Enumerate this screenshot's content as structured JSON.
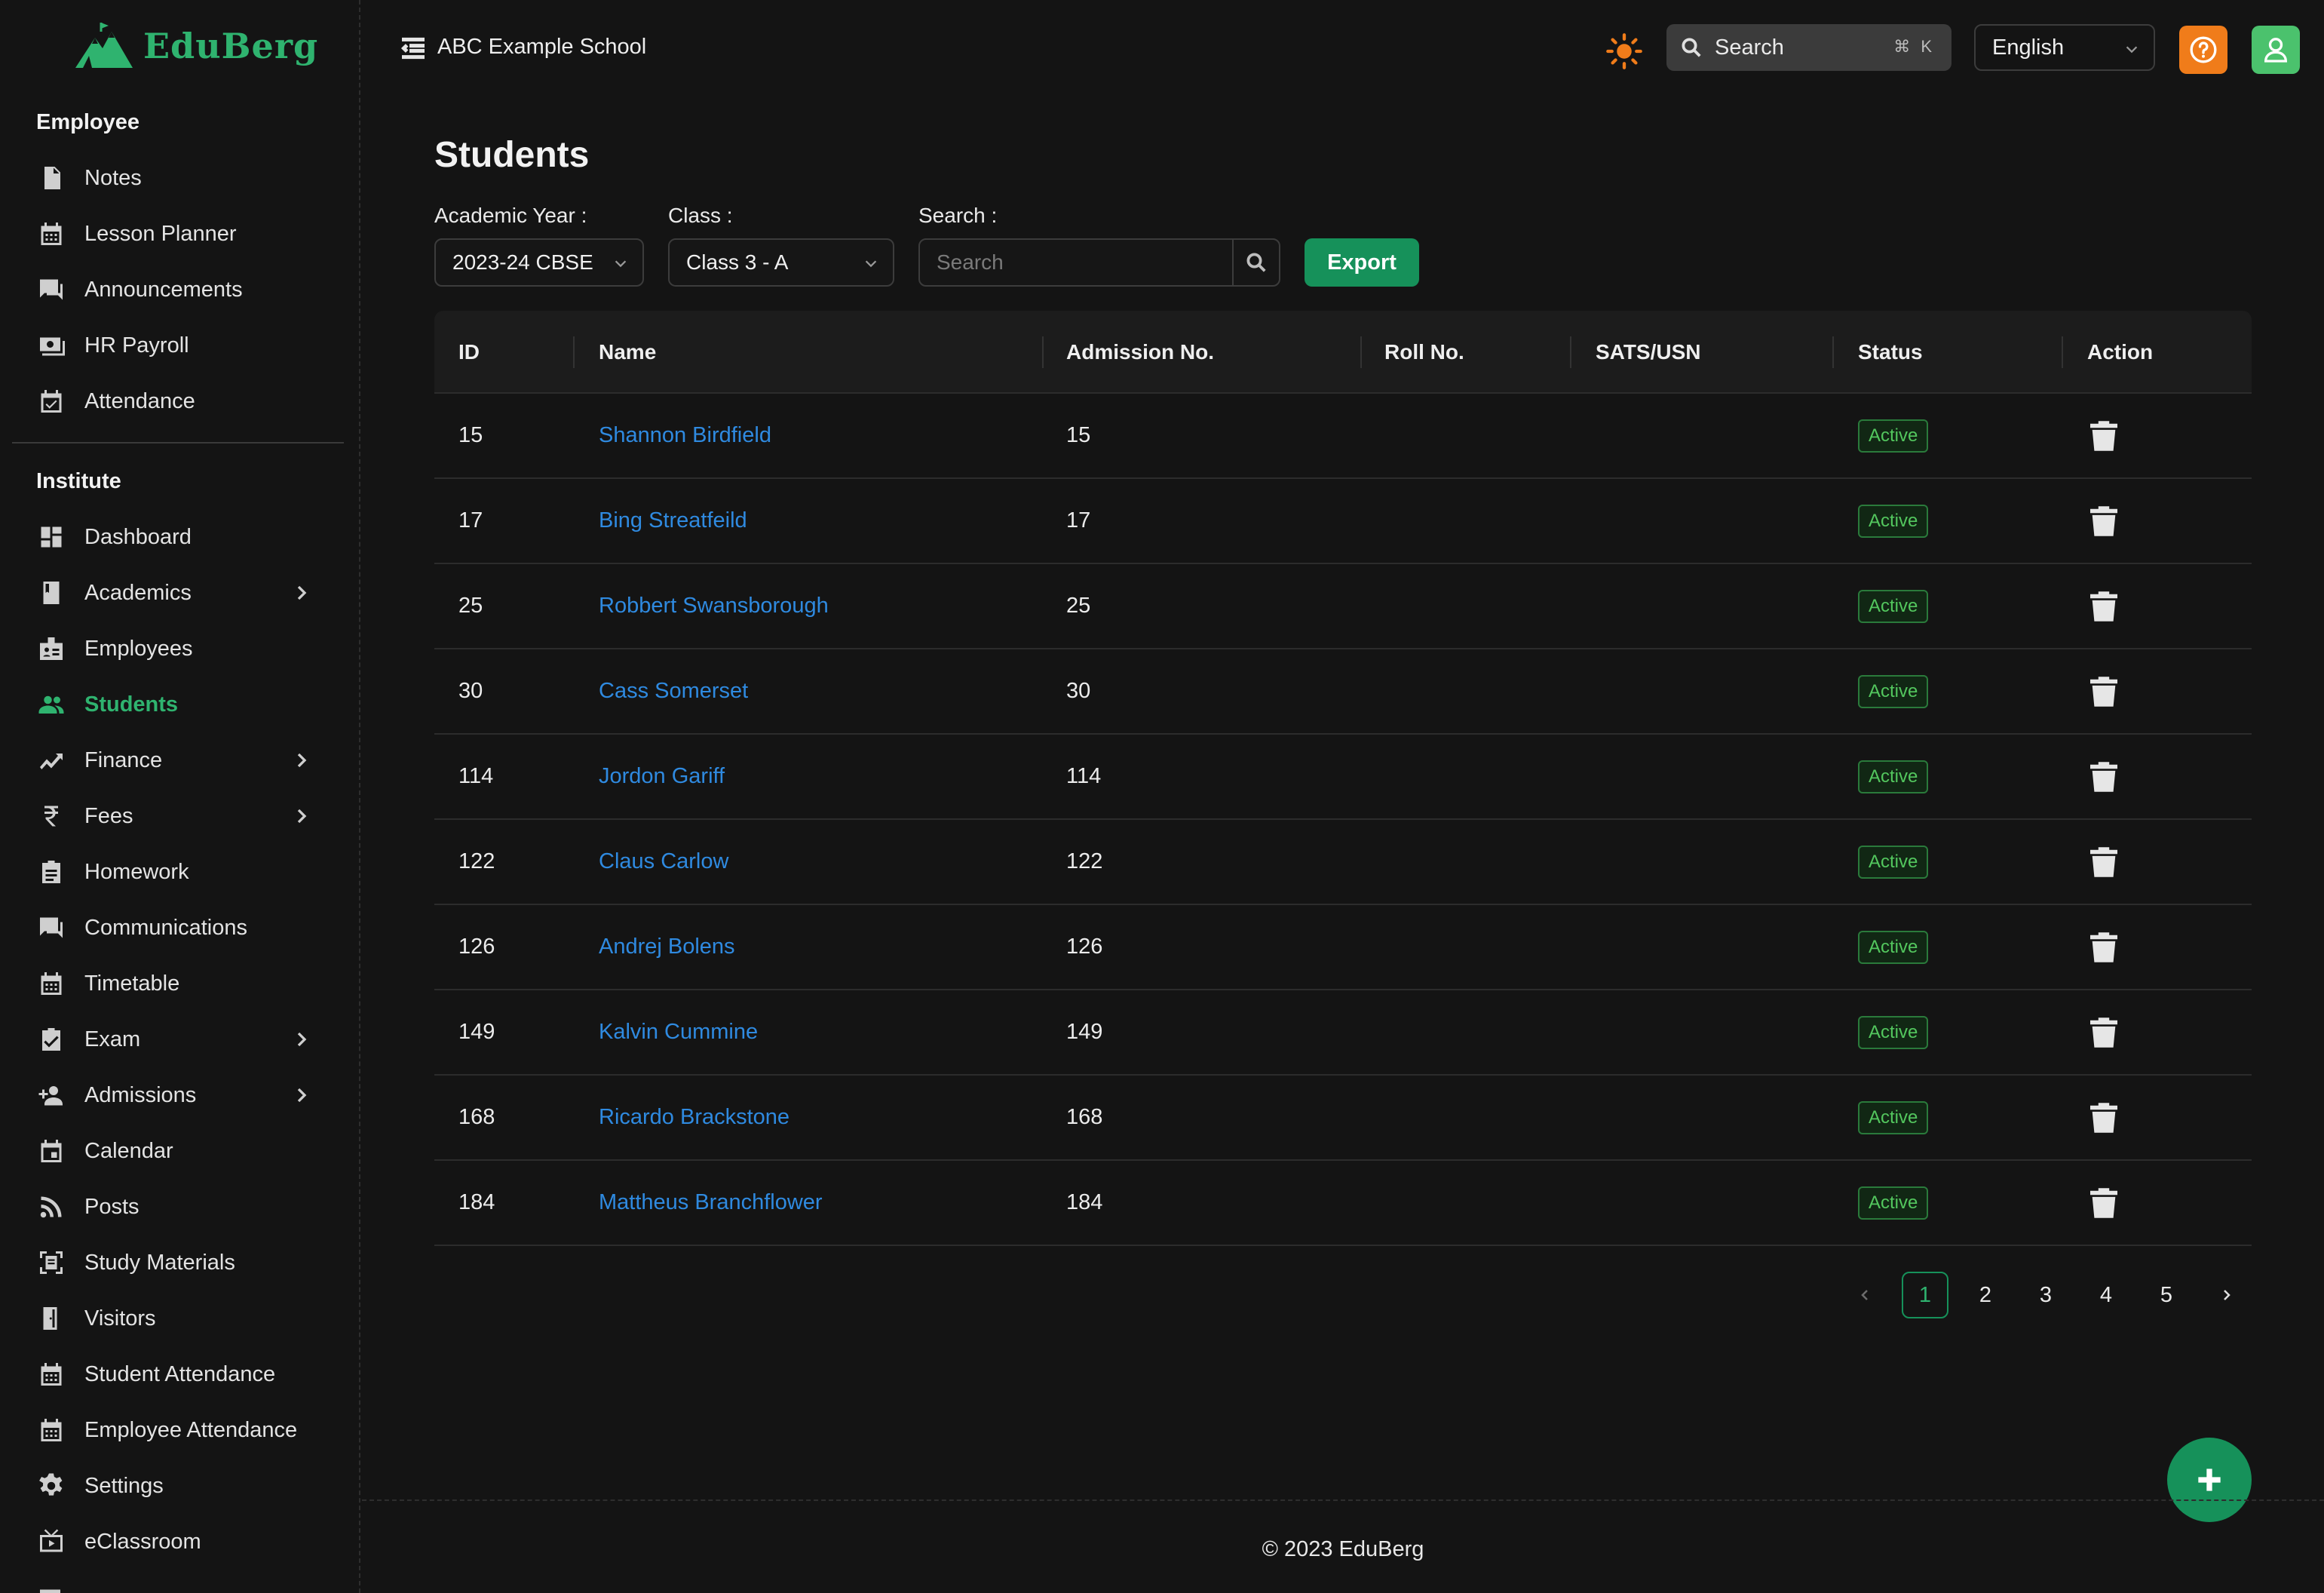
{
  "brand": {
    "name": "EduBerg",
    "accent": "#16915a",
    "logo_green": "#2fb36f"
  },
  "topbar": {
    "school_name": "ABC Example School",
    "search_placeholder": "Search",
    "search_shortcut": "⌘ K",
    "language": "English"
  },
  "sidebar": {
    "section_employee": "Employee",
    "employee_items": [
      {
        "label": "Notes",
        "icon": "notes-icon"
      },
      {
        "label": "Lesson Planner",
        "icon": "calendar-icon"
      },
      {
        "label": "Announcements",
        "icon": "chat-icon"
      },
      {
        "label": "HR Payroll",
        "icon": "payroll-icon"
      },
      {
        "label": "Attendance",
        "icon": "calendar-check-icon"
      }
    ],
    "section_institute": "Institute",
    "institute_items": [
      {
        "label": "Dashboard",
        "icon": "dashboard-icon"
      },
      {
        "label": "Academics",
        "icon": "book-icon",
        "expandable": true
      },
      {
        "label": "Employees",
        "icon": "id-badge-icon"
      },
      {
        "label": "Students",
        "icon": "people-icon",
        "active": true
      },
      {
        "label": "Finance",
        "icon": "trending-icon",
        "expandable": true
      },
      {
        "label": "Fees",
        "icon": "rupee-icon",
        "expandable": true
      },
      {
        "label": "Homework",
        "icon": "clipboard-icon"
      },
      {
        "label": "Communications",
        "icon": "chat-icon"
      },
      {
        "label": "Timetable",
        "icon": "calendar-icon"
      },
      {
        "label": "Exam",
        "icon": "clipboard-check-icon",
        "expandable": true
      },
      {
        "label": "Admissions",
        "icon": "person-add-icon",
        "expandable": true
      },
      {
        "label": "Calendar",
        "icon": "calendar-day-icon"
      },
      {
        "label": "Posts",
        "icon": "rss-icon"
      },
      {
        "label": "Study Materials",
        "icon": "document-scan-icon"
      },
      {
        "label": "Visitors",
        "icon": "door-icon"
      },
      {
        "label": "Student Attendance",
        "icon": "calendar-icon"
      },
      {
        "label": "Employee Attendance",
        "icon": "calendar-icon"
      },
      {
        "label": "Settings",
        "icon": "gear-icon"
      },
      {
        "label": "eClassroom",
        "icon": "tv-icon"
      }
    ]
  },
  "main": {
    "title": "Students",
    "filters": {
      "academic_year_label": "Academic Year :",
      "academic_year_value": "2023-24 CBSE",
      "class_label": "Class :",
      "class_value": "Class 3 - A",
      "search_label": "Search :",
      "search_placeholder": "Search",
      "export_label": "Export"
    },
    "table": {
      "columns": [
        "ID",
        "Name",
        "Admission No.",
        "Roll No.",
        "SATS/USN",
        "Status",
        "Action"
      ],
      "rows": [
        {
          "id": "15",
          "name": "Shannon Birdfield",
          "admission": "15",
          "roll": "",
          "sats": "",
          "status": "Active"
        },
        {
          "id": "17",
          "name": "Bing Streatfeild",
          "admission": "17",
          "roll": "",
          "sats": "",
          "status": "Active"
        },
        {
          "id": "25",
          "name": "Robbert Swansborough",
          "admission": "25",
          "roll": "",
          "sats": "",
          "status": "Active"
        },
        {
          "id": "30",
          "name": "Cass Somerset",
          "admission": "30",
          "roll": "",
          "sats": "",
          "status": "Active"
        },
        {
          "id": "114",
          "name": "Jordon Gariff",
          "admission": "114",
          "roll": "",
          "sats": "",
          "status": "Active"
        },
        {
          "id": "122",
          "name": "Claus Carlow",
          "admission": "122",
          "roll": "",
          "sats": "",
          "status": "Active"
        },
        {
          "id": "126",
          "name": "Andrej Bolens",
          "admission": "126",
          "roll": "",
          "sats": "",
          "status": "Active"
        },
        {
          "id": "149",
          "name": "Kalvin Cummine",
          "admission": "149",
          "roll": "",
          "sats": "",
          "status": "Active"
        },
        {
          "id": "168",
          "name": "Ricardo Brackstone",
          "admission": "168",
          "roll": "",
          "sats": "",
          "status": "Active"
        },
        {
          "id": "184",
          "name": "Mattheus Branchflower",
          "admission": "184",
          "roll": "",
          "sats": "",
          "status": "Active"
        }
      ]
    },
    "pagination": {
      "pages": [
        "1",
        "2",
        "3",
        "4",
        "5"
      ],
      "current": "1"
    }
  },
  "footer": {
    "text": "© 2023 EduBerg"
  }
}
